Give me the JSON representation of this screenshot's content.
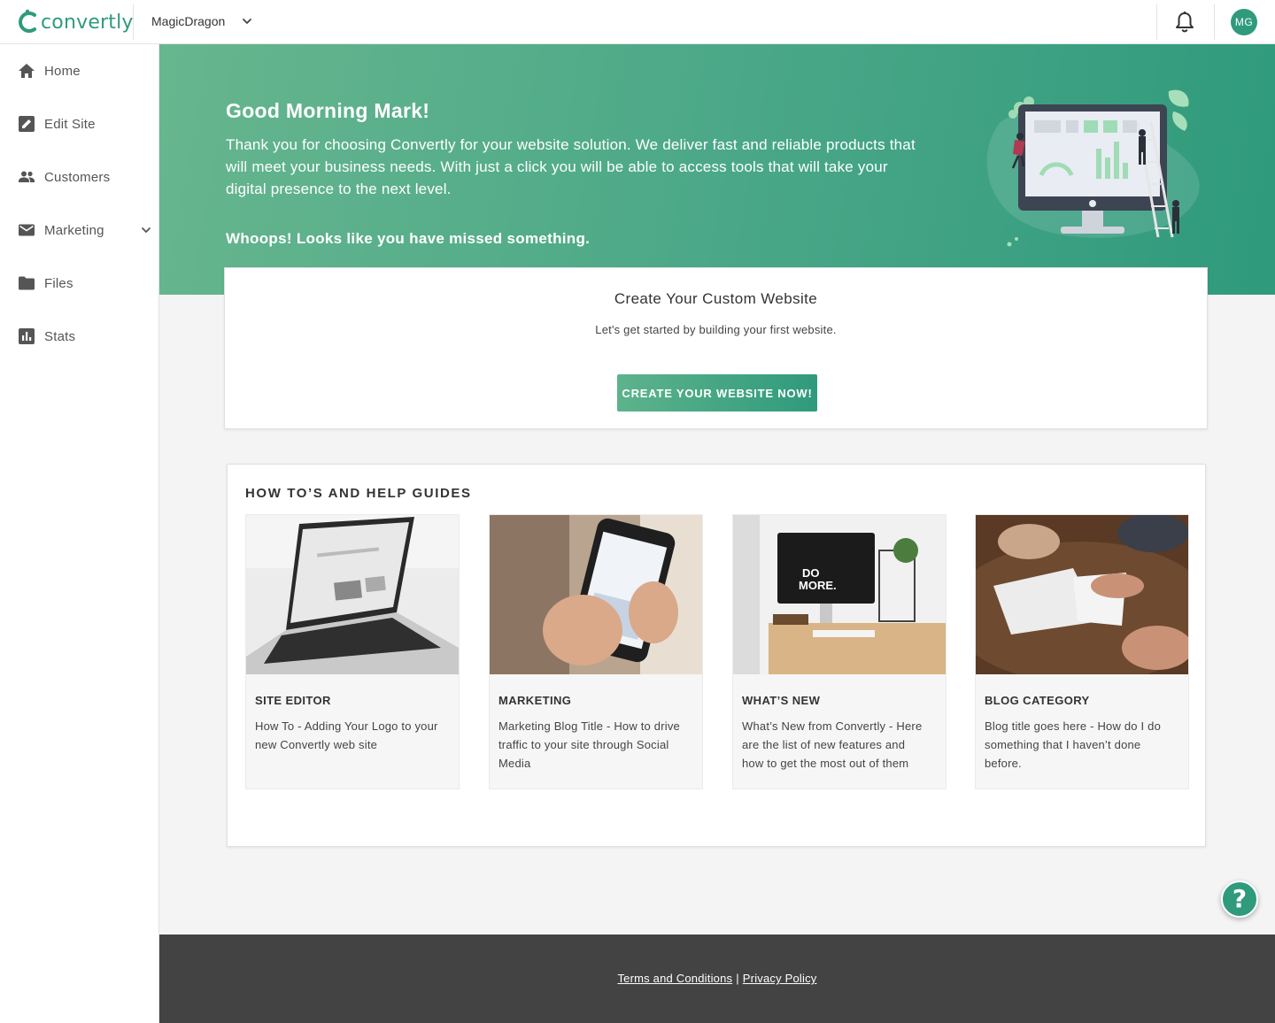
{
  "topbar": {
    "logo_text": "convertly",
    "site_name": "MagicDragon",
    "avatar_initials": "MG"
  },
  "sidebar": {
    "items": [
      {
        "label": "Home",
        "icon": "home-icon"
      },
      {
        "label": "Edit Site",
        "icon": "edit-icon"
      },
      {
        "label": "Customers",
        "icon": "people-icon"
      },
      {
        "label": "Marketing",
        "icon": "mail-icon",
        "expandable": true
      },
      {
        "label": "Files",
        "icon": "folder-icon"
      },
      {
        "label": "Stats",
        "icon": "bar-chart-icon"
      }
    ]
  },
  "hero": {
    "greeting": "Good Morning Mark!",
    "intro": "Thank you for choosing Convertly for your website solution. We deliver fast and reliable products that will meet your business needs. With just a click you will be able to access tools that will take your digital presence to the next level.",
    "warning": "Whoops! Looks like you have missed something."
  },
  "create_card": {
    "title": "Create Your Custom Website",
    "subtitle": "Let's get started by building your first website.",
    "button_label": "CREATE YOUR WEBSITE NOW!"
  },
  "guides": {
    "heading": "HOW TO’S AND HELP GUIDES",
    "cards": [
      {
        "category": "SITE EDITOR",
        "title": "How To - Adding Your Logo to your new Convertly web site"
      },
      {
        "category": "MARKETING",
        "title": "Marketing Blog Title - How to drive traffic to your site through Social Media"
      },
      {
        "category": "WHAT’S NEW",
        "title": "What’s New from Convertly - Here are the list of new features and how to get the most out of them"
      },
      {
        "category": "BLOG CATEGORY",
        "title": "Blog title goes here - How do I do something that I haven’t done before."
      }
    ]
  },
  "footer": {
    "terms": "Terms and Conditions",
    "separator": "|",
    "privacy": "Privacy Policy"
  },
  "help": {
    "label": "?"
  },
  "colors": {
    "brand": "#2f9a7c",
    "brand_light": "#67b68e",
    "footer": "#434343"
  }
}
